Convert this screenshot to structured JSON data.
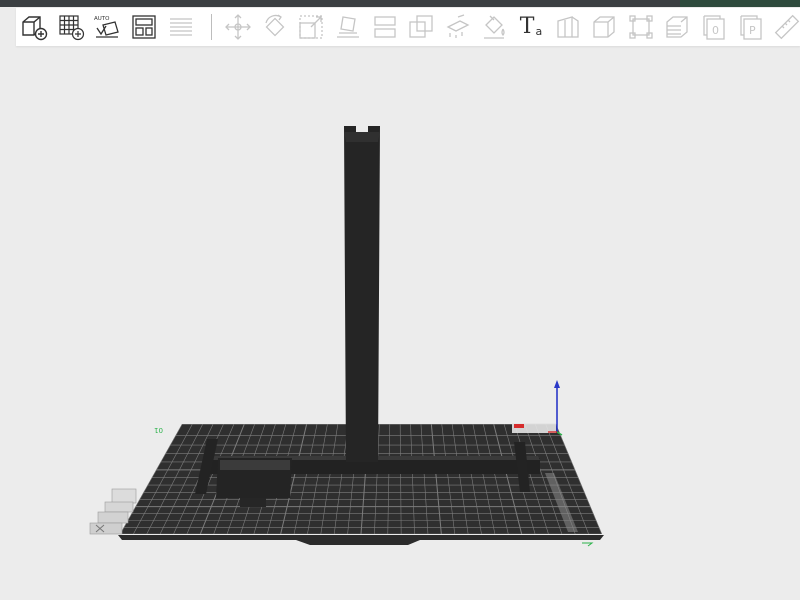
{
  "toolbar": {
    "tools": [
      {
        "name": "add-object",
        "enabled": true
      },
      {
        "name": "arrange-grid",
        "enabled": true
      },
      {
        "name": "auto-orient",
        "enabled": true,
        "label": "AUTO"
      },
      {
        "name": "plate-layout",
        "enabled": true
      },
      {
        "name": "slice-layers",
        "enabled": true
      },
      {
        "name": "move",
        "enabled": false
      },
      {
        "name": "rotate",
        "enabled": false
      },
      {
        "name": "scale",
        "enabled": false
      },
      {
        "name": "lay-on-face",
        "enabled": false
      },
      {
        "name": "cut",
        "enabled": false
      },
      {
        "name": "boolean",
        "enabled": false
      },
      {
        "name": "support-paint",
        "enabled": false
      },
      {
        "name": "color-paint",
        "enabled": false
      },
      {
        "name": "text",
        "enabled": true,
        "label": "T",
        "sub": "a"
      },
      {
        "name": "seam-paint",
        "enabled": false
      },
      {
        "name": "hollow",
        "enabled": false
      },
      {
        "name": "fit-frame",
        "enabled": false
      },
      {
        "name": "variable-layer-height",
        "enabled": false
      },
      {
        "name": "object-0",
        "enabled": false,
        "label": "0"
      },
      {
        "name": "object-p",
        "enabled": false,
        "label": "P"
      },
      {
        "name": "measure",
        "enabled": false
      }
    ]
  },
  "viewport": {
    "plate_label": "01",
    "axes": {
      "x_color": "#d62c2c",
      "y_color": "#2bb24a",
      "z_color": "#2a38c8"
    },
    "colors": {
      "background": "#ececec",
      "plate": "#2d2d2d",
      "grid": "#7a7a7a",
      "model": "#262626"
    }
  }
}
